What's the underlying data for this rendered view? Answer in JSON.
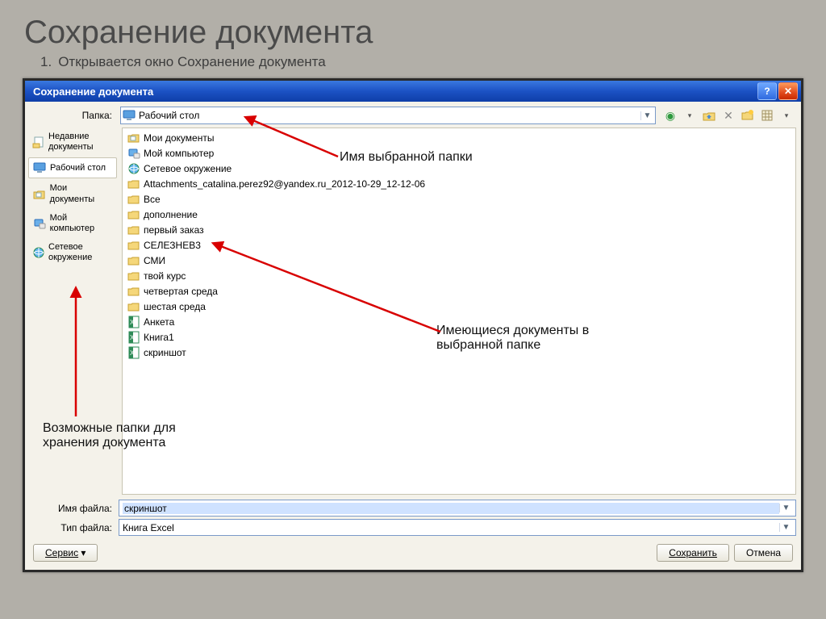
{
  "slide": {
    "title": "Сохранение документа",
    "list_num": "1.",
    "list_text": "Открывается окно Сохранение документа"
  },
  "dialog": {
    "title": "Сохранение документа",
    "folder_label": "Папка:",
    "folder_value": "Рабочий стол",
    "places": [
      {
        "label": "Недавние документы",
        "icon": "recent"
      },
      {
        "label": "Рабочий стол",
        "icon": "desktop",
        "selected": true
      },
      {
        "label": "Мои документы",
        "icon": "mydocs"
      },
      {
        "label": "Мой компьютер",
        "icon": "mypc"
      },
      {
        "label": "Сетевое окружение",
        "icon": "network"
      }
    ],
    "items": [
      {
        "label": "Мои документы",
        "icon": "mydocs"
      },
      {
        "label": "Мой компьютер",
        "icon": "mypc"
      },
      {
        "label": "Сетевое окружение",
        "icon": "network"
      },
      {
        "label": "Attachments_catalina.perez92@yandex.ru_2012-10-29_12-12-06",
        "icon": "folder"
      },
      {
        "label": "Все",
        "icon": "folder"
      },
      {
        "label": "дополнение",
        "icon": "folder"
      },
      {
        "label": "первый заказ",
        "icon": "folder"
      },
      {
        "label": "СЕЛЕЗНЕВ3",
        "icon": "folder"
      },
      {
        "label": "СМИ",
        "icon": "folder"
      },
      {
        "label": "твой курс",
        "icon": "folder"
      },
      {
        "label": "четвертая среда",
        "icon": "folder"
      },
      {
        "label": "шестая среда",
        "icon": "folder"
      },
      {
        "label": "Анкета",
        "icon": "xls"
      },
      {
        "label": "Книга1",
        "icon": "xls"
      },
      {
        "label": "скриншот",
        "icon": "xls"
      }
    ],
    "filename_label": "Имя файла:",
    "filename_value": "скриншот",
    "filetype_label": "Тип файла:",
    "filetype_value": "Книга Excel",
    "service_btn": "Сервис",
    "save_btn": "Сохранить",
    "cancel_btn": "Отмена"
  },
  "annotations": {
    "a1": "Имя выбранной папки",
    "a2": "Имеющиеся документы в выбранной папке",
    "a3": "Возможные папки для хранения документа"
  }
}
